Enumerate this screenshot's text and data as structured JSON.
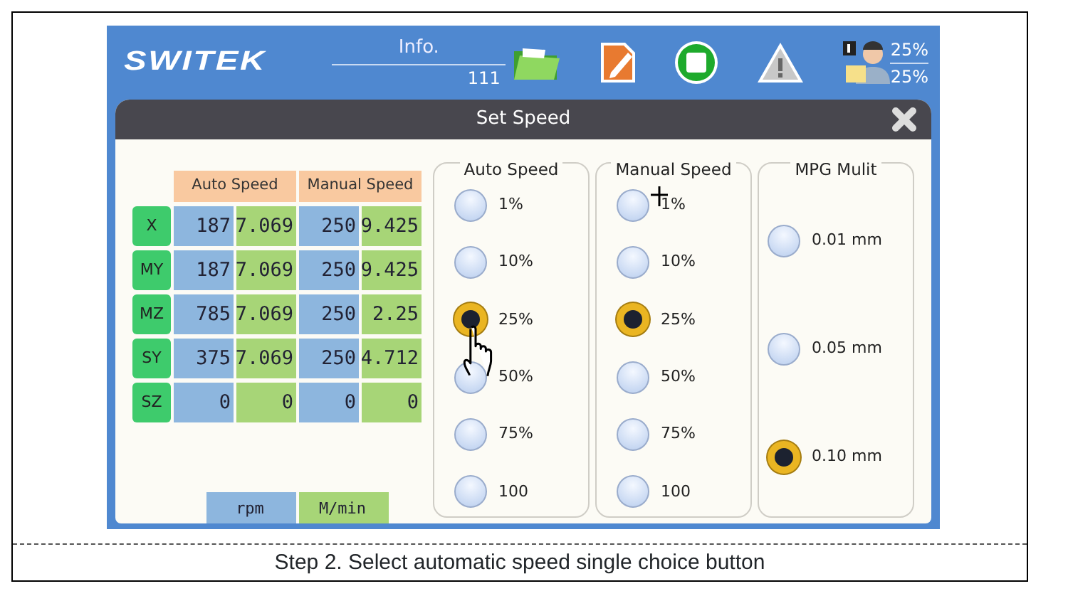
{
  "header": {
    "logo": "SWITEK",
    "info_label": "Info.",
    "info_value": "111",
    "feed_override": "25%",
    "spindle_override": "25%"
  },
  "dialog": {
    "title": "Set Speed"
  },
  "speed_table": {
    "headers": [
      "Auto Speed",
      "Manual Speed"
    ],
    "rows": [
      {
        "axis": "X",
        "auto_rpm": "187",
        "auto_mmin": "7.069",
        "manual_rpm": "250",
        "manual_mmin": "9.425"
      },
      {
        "axis": "MY",
        "auto_rpm": "187",
        "auto_mmin": "7.069",
        "manual_rpm": "250",
        "manual_mmin": "9.425"
      },
      {
        "axis": "MZ",
        "auto_rpm": "785",
        "auto_mmin": "7.069",
        "manual_rpm": "250",
        "manual_mmin": "2.25"
      },
      {
        "axis": "SY",
        "auto_rpm": "375",
        "auto_mmin": "7.069",
        "manual_rpm": "250",
        "manual_mmin": "4.712"
      },
      {
        "axis": "SZ",
        "auto_rpm": "0",
        "auto_mmin": "0",
        "manual_rpm": "0",
        "manual_mmin": "0"
      }
    ],
    "units": [
      "rpm",
      "M/min"
    ]
  },
  "groups": [
    {
      "title": "Auto Speed",
      "options": [
        {
          "label": "1%",
          "selected": false
        },
        {
          "label": "10%",
          "selected": false
        },
        {
          "label": "25%",
          "selected": true
        },
        {
          "label": "50%",
          "selected": false
        },
        {
          "label": "75%",
          "selected": false
        },
        {
          "label": "100",
          "selected": false
        }
      ]
    },
    {
      "title": "Manual Speed",
      "options": [
        {
          "label": "1%",
          "selected": false
        },
        {
          "label": "10%",
          "selected": false
        },
        {
          "label": "25%",
          "selected": true
        },
        {
          "label": "50%",
          "selected": false
        },
        {
          "label": "75%",
          "selected": false
        },
        {
          "label": "100",
          "selected": false
        }
      ]
    },
    {
      "title": "MPG Mulit",
      "options": [
        {
          "label": "0.01 mm",
          "selected": false
        },
        {
          "label": "0.05 mm",
          "selected": false
        },
        {
          "label": "0.10 mm",
          "selected": true
        }
      ]
    }
  ],
  "caption": "Step 2. Select automatic speed single choice button"
}
